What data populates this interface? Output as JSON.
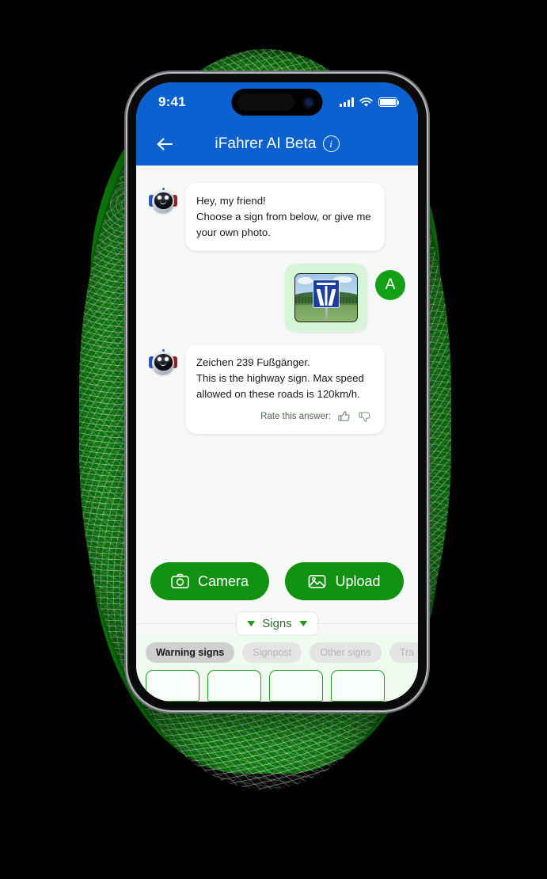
{
  "status_bar": {
    "time": "9:41",
    "signal_icon": "cellular-bars-icon",
    "wifi_icon": "wifi-icon",
    "battery_icon": "battery-icon"
  },
  "header": {
    "back_icon": "back-arrow-icon",
    "title": "iFahrer AI Beta",
    "info_icon": "info-icon",
    "info_glyph": "i",
    "background_color": "#0b61cf"
  },
  "chat": {
    "messages": [
      {
        "sender": "bot",
        "avatar_icon": "robot-avatar-icon",
        "text": "Hey, my friend!\nChoose a sign from below, or give me your own photo."
      },
      {
        "sender": "user",
        "avatar_initial": "A",
        "avatar_color": "#14a014",
        "attachment_icon": "autobahn-sign-photo",
        "attachment_alt": "Photo of German Autobahn highway sign"
      },
      {
        "sender": "bot",
        "avatar_icon": "robot-avatar-icon",
        "text": "Zeichen 239 Fußgänger.\nThis is the highway sign. Max speed allowed on these roads is 120km/h.",
        "rate_label": "Rate this answer:",
        "thumbs_up_icon": "thumbs-up-icon",
        "thumbs_down_icon": "thumbs-down-icon"
      }
    ]
  },
  "actions": {
    "camera": {
      "label": "Camera",
      "icon": "camera-icon"
    },
    "upload": {
      "label": "Upload",
      "icon": "image-upload-icon"
    },
    "button_color": "#119211"
  },
  "signs_toggle": {
    "label": "Signs",
    "left_icon": "triangle-down-icon",
    "right_icon": "triangle-down-icon",
    "accent_color": "#1e9c1e"
  },
  "tabs": [
    {
      "label": "Warning signs",
      "active": true
    },
    {
      "label": "Signpost",
      "active": false
    },
    {
      "label": "Other signs",
      "active": false
    },
    {
      "label": "Tra",
      "active": false
    }
  ],
  "sign_cards": [
    {
      "name": "sign-card-1"
    },
    {
      "name": "sign-card-2"
    },
    {
      "name": "sign-card-3"
    },
    {
      "name": "sign-card-4"
    }
  ],
  "background": {
    "blob_color": "#0b750b",
    "page_color": "#000000"
  }
}
